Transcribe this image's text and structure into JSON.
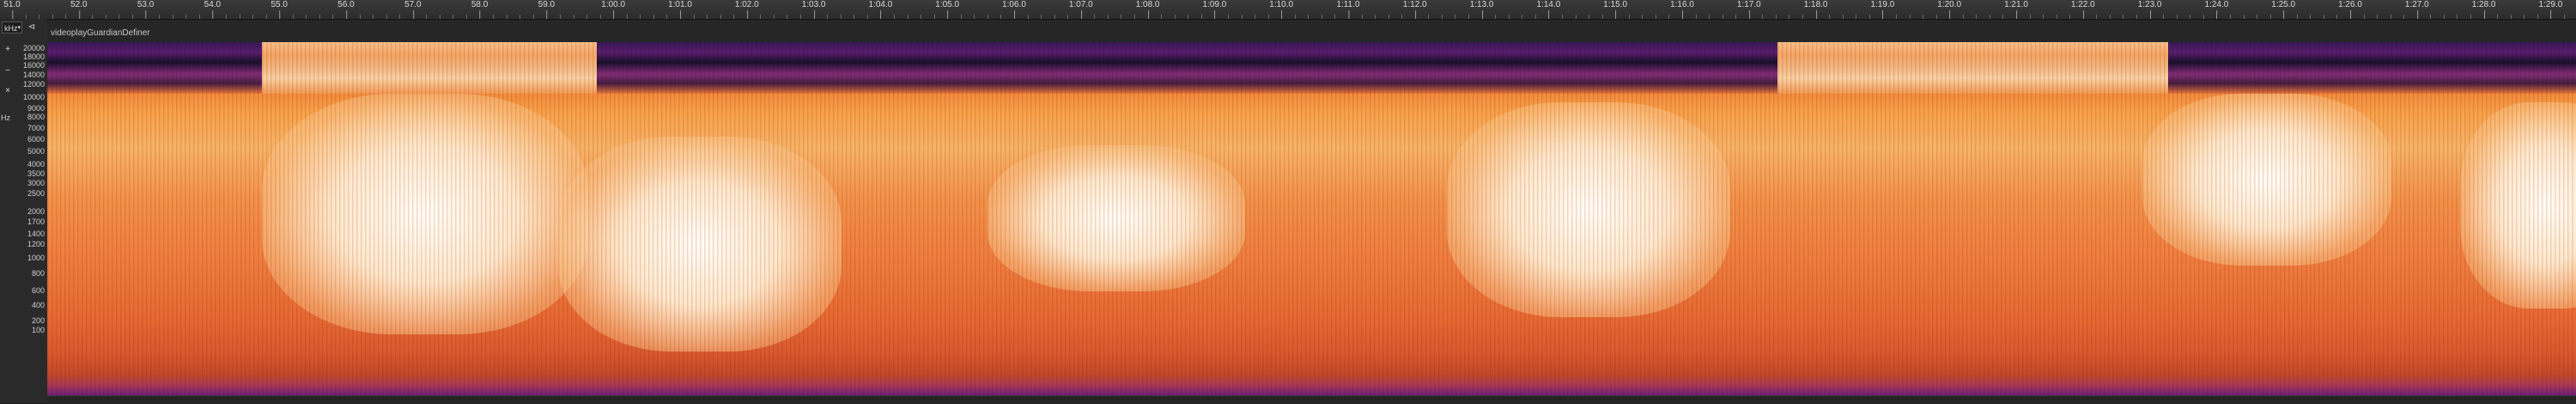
{
  "timeline": {
    "labels": [
      "51.0",
      "52.0",
      "53.0",
      "54.0",
      "55.0",
      "56.0",
      "57.0",
      "58.0",
      "59.0",
      "1:00.0",
      "1:01.0",
      "1:02.0",
      "1:03.0",
      "1:04.0",
      "1:05.0",
      "1:06.0",
      "1:07.0",
      "1:08.0",
      "1:09.0",
      "1:10.0",
      "1:11.0",
      "1:12.0",
      "1:13.0",
      "1:14.0",
      "1:15.0",
      "1:16.0",
      "1:17.0",
      "1:18.0",
      "1:19.0",
      "1:20.0",
      "1:21.0",
      "1:22.0",
      "1:23.0",
      "1:24.0",
      "1:25.0",
      "1:26.0",
      "1:27.0",
      "1:28.0",
      "1:29.0"
    ]
  },
  "track": {
    "name": "videoplayGuardianDefiner"
  },
  "controls": {
    "zoom_select": "kHz",
    "pin": "⊲",
    "plus": "+",
    "minus": "−",
    "reset": "×",
    "unit_label": "Hz"
  },
  "frequency_scale": [
    "20000",
    "18000",
    "16000",
    "14000",
    "12000",
    "10000",
    "9000",
    "8000",
    "7000",
    "6000",
    "5000",
    "4000",
    "3500",
    "3000",
    "2500",
    "2000",
    "1700",
    "1400",
    "1200",
    "1000",
    "800",
    "600",
    "400",
    "200",
    "100"
  ],
  "colors": {
    "ruler": "#2f2f2f",
    "background": "#1b1b1b",
    "spectrum_low": "#2a0f3e",
    "spectrum_mid": "#e8693f",
    "spectrum_high": "#fffdf6"
  }
}
